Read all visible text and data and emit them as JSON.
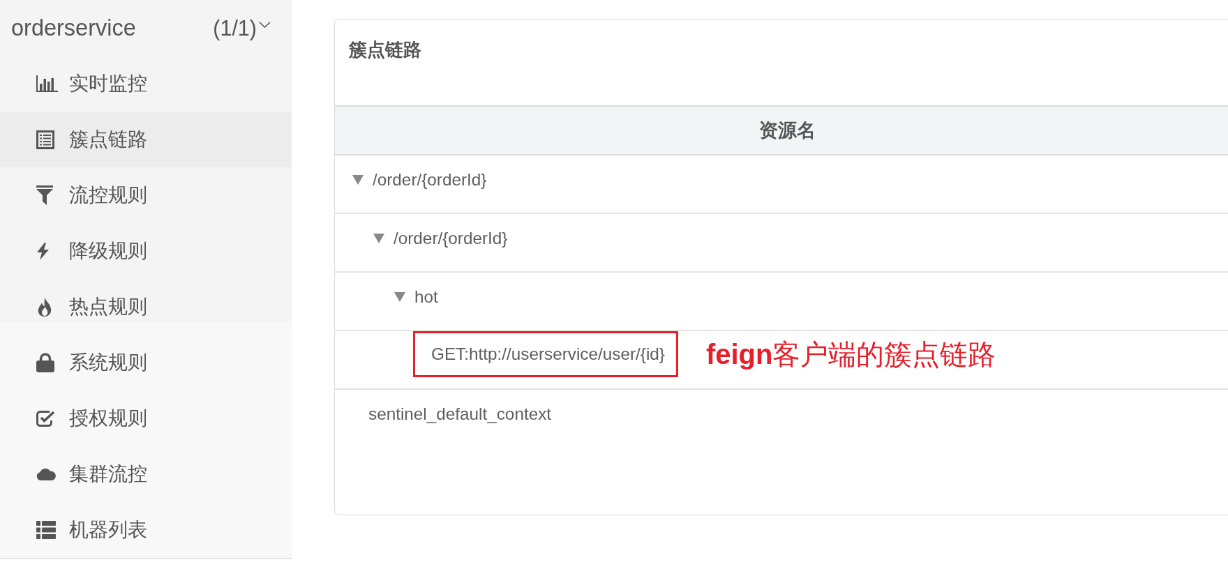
{
  "sidebar": {
    "app": {
      "name": "orderservice",
      "count": "(1/1)",
      "expanded": true
    },
    "items": [
      {
        "kind": "monitor",
        "label": "实时监控",
        "selected": false
      },
      {
        "kind": "chain",
        "label": "簇点链路",
        "selected": true
      },
      {
        "kind": "flow",
        "label": "流控规则",
        "selected": false
      },
      {
        "kind": "degrade",
        "label": "降级规则",
        "selected": false
      },
      {
        "kind": "hotspot",
        "label": "热点规则",
        "selected": false
      },
      {
        "kind": "system",
        "label": "系统规则",
        "selected": false
      },
      {
        "kind": "authority",
        "label": "授权规则",
        "selected": false
      },
      {
        "kind": "cluster",
        "label": "集群流控",
        "selected": false
      },
      {
        "kind": "machines",
        "label": "机器列表",
        "selected": false
      }
    ]
  },
  "panel": {
    "title": "簇点链路",
    "table": {
      "columns": [
        "资源名"
      ],
      "rows": [
        {
          "name": "/order/{orderId}",
          "expanded": true,
          "highlighted": false,
          "children": [
            {
              "name": "/order/{orderId}",
              "expanded": true,
              "highlighted": false,
              "children": [
                {
                  "name": "hot",
                  "expanded": true,
                  "highlighted": false,
                  "children": [
                    {
                      "name": "GET:http://userservice/user/{id}",
                      "highlighted": true,
                      "note": "**feign**客户端的簇点链路"
                    }
                  ]
                }
              ]
            }
          ]
        },
        {
          "name": "sentinel_default_context",
          "highlighted": false
        }
      ]
    }
  }
}
